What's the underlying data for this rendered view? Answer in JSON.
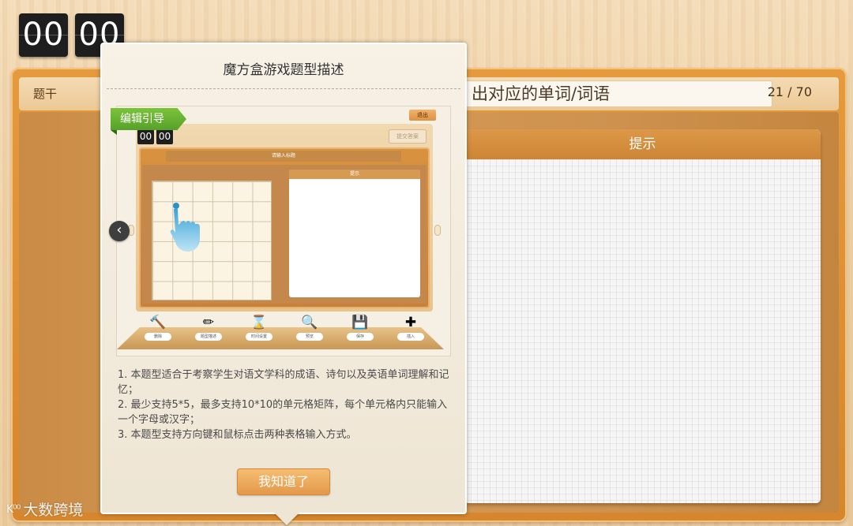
{
  "timer": {
    "minutes": "00",
    "seconds": "00"
  },
  "stem": {
    "label": "题干",
    "text": "出对应的单词/词语",
    "page": "21 / 70"
  },
  "hint": {
    "title": "提示"
  },
  "modal": {
    "title": "魔方盒游戏题型描述",
    "guide_ribbon": "编辑引导",
    "preview": {
      "exit": "退出",
      "timer": {
        "minutes": "00",
        "seconds": "00"
      },
      "submit": "提交答案",
      "title_placeholder": "请输入标题",
      "hint_title": "提示",
      "tools": [
        {
          "icon": "hammer-icon",
          "glyph": "🔨",
          "label": "删除"
        },
        {
          "icon": "pencil-icon",
          "glyph": "✏",
          "label": "题型描述"
        },
        {
          "icon": "hourglass-icon",
          "glyph": "⌛",
          "label": "时间设置"
        },
        {
          "icon": "magnifier-icon",
          "glyph": "🔍",
          "label": "预览"
        },
        {
          "icon": "usb-drive-icon",
          "glyph": "💾",
          "label": "保存"
        },
        {
          "icon": "insert-icon",
          "glyph": "✚",
          "label": "插入"
        }
      ]
    },
    "description": [
      "1. 本题型适合于考察学生对语文学科的成语、诗句以及英语单词理解和记忆；",
      "2. 最少支持5*5，最多支持10*10的单元格矩阵，每个单元格内只能输入一个字母或汉字；",
      "3. 本题型支持方向键和鼠标点击两种表格输入方式。"
    ],
    "ok_button": "我知道了"
  },
  "watermark": {
    "logo": "K⁰⁰",
    "text": "大数跨境"
  }
}
